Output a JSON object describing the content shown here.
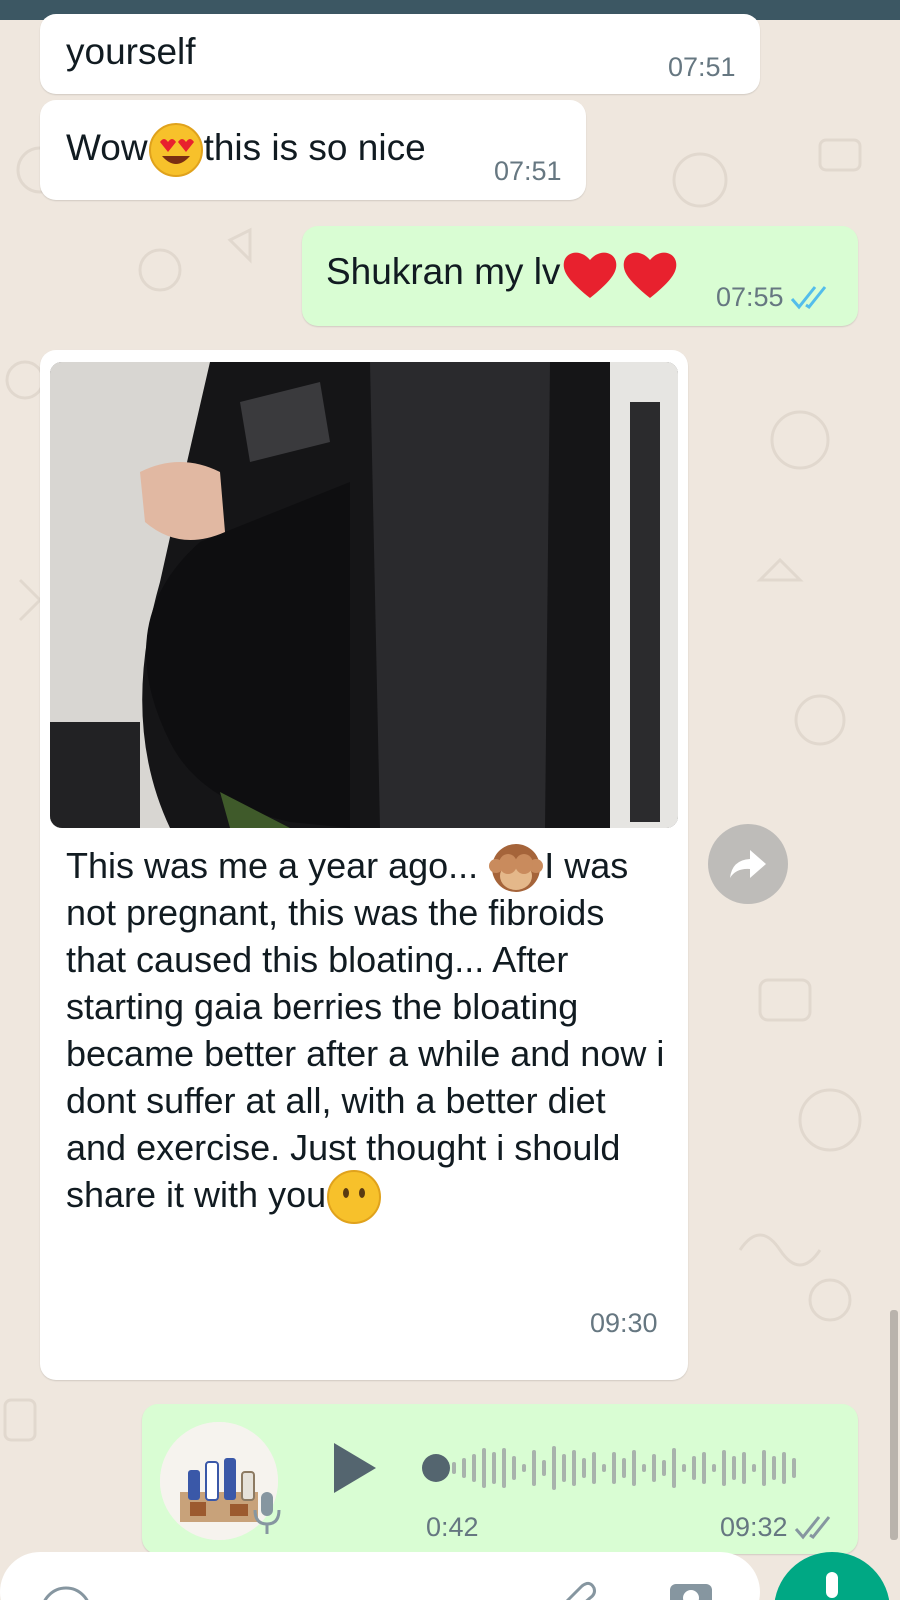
{
  "messages": [
    {
      "id": "m1",
      "direction": "incoming",
      "text": "yourself",
      "time": "07:51"
    },
    {
      "id": "m2",
      "direction": "incoming",
      "text_before": "Wow",
      "text_after": "this is so nice",
      "emoji": "heart-eyes-emoji",
      "time": "07:51"
    },
    {
      "id": "m3",
      "direction": "outgoing",
      "text": "Shukran my lv",
      "emoji": "red-heart-emoji",
      "time": "07:55",
      "status": "read"
    },
    {
      "id": "m4",
      "direction": "incoming",
      "type": "image",
      "caption_line1": "This was me a year ago... ",
      "caption_after_emoji": "I",
      "caption_body": "was not pregnant,  this was the fibroids that caused this bloating... After starting gaia berries the bloating became better after a while and now i dont suffer at all, with a better diet and exercise. Just thought i",
      "caption_last": "should share it with you",
      "emoji1": "see-no-evil-monkey-emoji",
      "emoji2": "no-mouth-face-emoji",
      "time": "09:30"
    },
    {
      "id": "m5",
      "direction": "outgoing",
      "type": "voice",
      "duration": "0:42",
      "time": "09:32",
      "status": "delivered"
    }
  ],
  "colors": {
    "chat_bg": "#efe7de",
    "incoming_bubble": "#ffffff",
    "outgoing_bubble": "#d9fdd3",
    "read_tick": "#53bdeb",
    "accent": "#00a884",
    "top_bar": "#3c5763"
  },
  "icons": [
    "forward-icon",
    "play-icon",
    "mic-icon",
    "send-mic-icon",
    "double-tick-icon"
  ]
}
